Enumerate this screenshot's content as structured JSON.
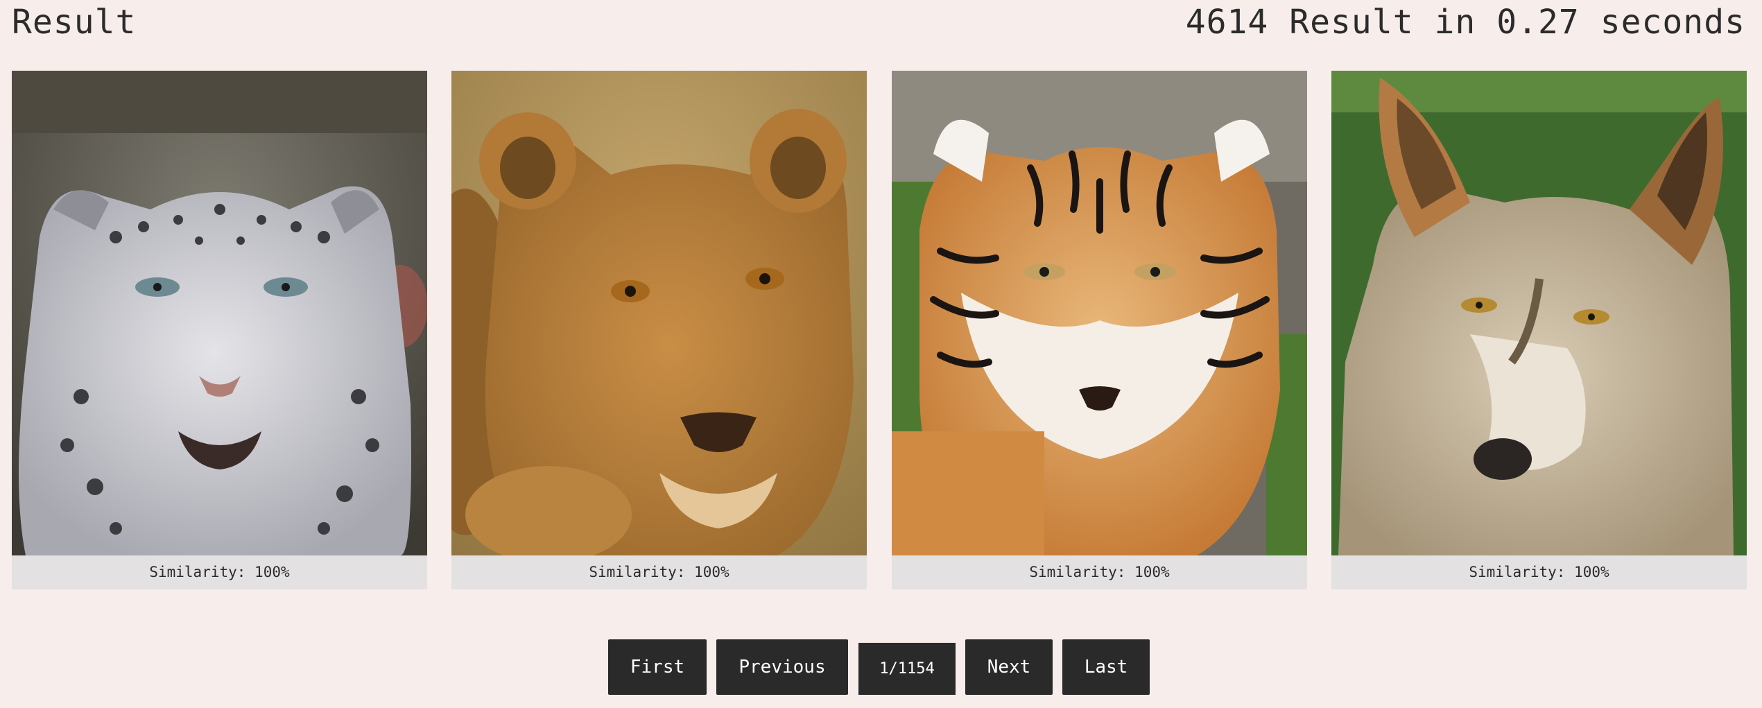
{
  "header": {
    "title": "Result",
    "stats": "4614 Result in 0.27 seconds"
  },
  "results": [
    {
      "animal": "snow-leopard",
      "similarity": "Similarity: 100%"
    },
    {
      "animal": "lioness",
      "similarity": "Similarity: 100%"
    },
    {
      "animal": "tiger",
      "similarity": "Similarity: 100%"
    },
    {
      "animal": "wolf",
      "similarity": "Similarity: 100%"
    }
  ],
  "pagination": {
    "first": "First",
    "previous": "Previous",
    "indicator": "1/1154",
    "next": "Next",
    "last": "Last"
  },
  "colors": {
    "background": "#f7eeeb",
    "button": "#2a2a2a",
    "caption": "#e3e1e1"
  }
}
